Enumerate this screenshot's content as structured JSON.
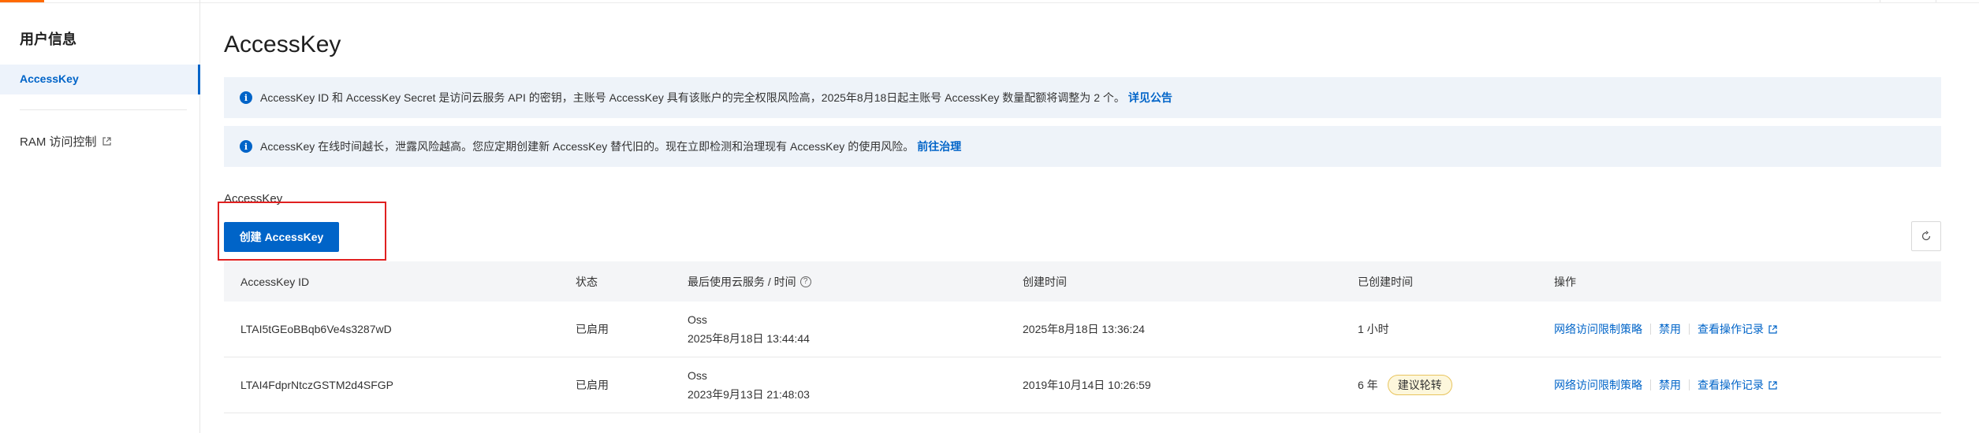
{
  "sidebar": {
    "title": "用户信息",
    "active_item": "AccessKey",
    "ram_item": "RAM 访问控制"
  },
  "main": {
    "title": "AccessKey",
    "notices": [
      {
        "text": "AccessKey ID 和 AccessKey Secret 是访问云服务 API 的密钥，主账号 AccessKey 具有该账户的完全权限风险高，2025年8月18日起主账号 AccessKey 数量配额将调整为 2 个。",
        "link": "详见公告"
      },
      {
        "text": "AccessKey 在线时间越长，泄露风险越高。您应定期创建新 AccessKey 替代旧的。现在立即检测和治理现有 AccessKey 的使用风险。",
        "link": "前往治理"
      }
    ],
    "section_label": "AccessKey",
    "create_button": "创建 AccessKey",
    "table": {
      "headers": {
        "id": "AccessKey ID",
        "status": "状态",
        "last_used": "最后使用云服务 / 时间",
        "created": "创建时间",
        "age": "已创建时间",
        "ops": "操作"
      },
      "rows": [
        {
          "id": "LTAI5tGEoBBqb6Ve4s3287wD",
          "status": "已启用",
          "last_service": "Oss",
          "last_time": "2025年8月18日 13:44:44",
          "created": "2025年8月18日 13:36:24",
          "age": "1 小时",
          "badge": "",
          "op_policy": "网络访问限制策略",
          "op_disable": "禁用",
          "op_log": "查看操作记录"
        },
        {
          "id": "LTAI4FdprNtczGSTM2d4SFGP",
          "status": "已启用",
          "last_service": "Oss",
          "last_time": "2023年9月13日 21:48:03",
          "created": "2019年10月14日 10:26:59",
          "age": "6 年",
          "badge": "建议轮转",
          "op_policy": "网络访问限制策略",
          "op_disable": "禁用",
          "op_log": "查看操作记录"
        }
      ]
    }
  },
  "colors": {
    "accent": "#0064c8",
    "brand_orange": "#ff6a00",
    "notice_bg": "#eef3f9",
    "highlight": "#e02020",
    "badge_bg": "#fdf7dc"
  },
  "icons": [
    "info-icon",
    "external-link-icon",
    "help-circle-icon",
    "refresh-icon"
  ]
}
